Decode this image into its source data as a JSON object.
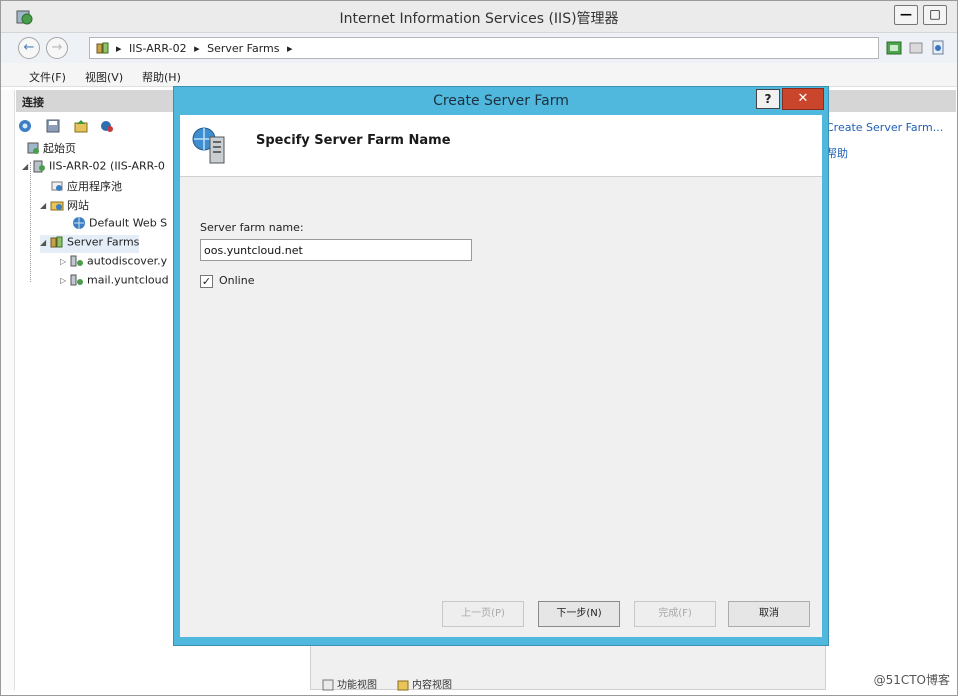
{
  "window": {
    "title": "Internet Information Services (IIS)管理器",
    "minimize_glyph": "—",
    "maximize_glyph": "□"
  },
  "address_bar": {
    "back_glyph": "←",
    "forward_glyph": "→",
    "separator": "▸",
    "crumbs": [
      "IIS-ARR-02",
      "Server Farms"
    ],
    "trailing_separator": "▸"
  },
  "menu": {
    "file": "文件(F)",
    "view": "视图(V)",
    "help": "帮助(H)"
  },
  "connections": {
    "header": "连接",
    "tree": {
      "start_page": "起始页",
      "server": "IIS-ARR-02 (IIS-ARR-0",
      "app_pools": "应用程序池",
      "sites": "网站",
      "default_site": "Default Web S",
      "server_farms": "Server Farms",
      "farm1": "autodiscover.y",
      "farm2": "mail.yuntcloud"
    }
  },
  "actions": {
    "create_farm": "Create Server Farm...",
    "help": "帮助"
  },
  "bottom_tabs": {
    "features_view": "功能视图",
    "content_view": "内容视图"
  },
  "dialog": {
    "title": "Create Server Farm",
    "help_glyph": "?",
    "close_glyph": "✕",
    "heading": "Specify Server Farm Name",
    "name_label": "Server farm name:",
    "name_value": "oos.yuntcloud.net",
    "online_checked": true,
    "check_glyph": "✓",
    "online_label": "Online",
    "buttons": {
      "prev": "上一页(P)",
      "next": "下一步(N)",
      "finish": "完成(F)",
      "cancel": "取消"
    }
  },
  "watermark": "@51CTO博客",
  "colors": {
    "dialog_frame": "#4fb8dc",
    "close_button": "#c9462c",
    "link": "#1e5fb4"
  }
}
